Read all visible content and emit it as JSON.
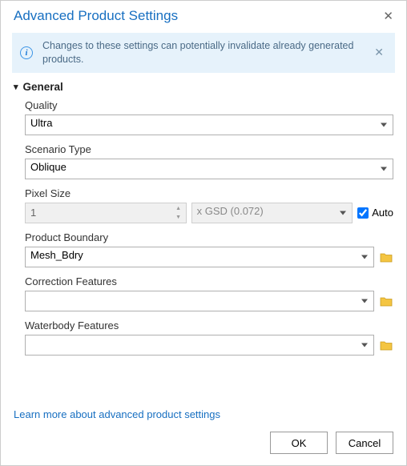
{
  "dialog": {
    "title": "Advanced Product Settings"
  },
  "banner": {
    "text": "Changes to these settings can potentially invalidate already generated products."
  },
  "section": {
    "general_label": "General"
  },
  "fields": {
    "quality": {
      "label": "Quality",
      "value": "Ultra"
    },
    "scenario": {
      "label": "Scenario Type",
      "value": "Oblique"
    },
    "pixel_size": {
      "label": "Pixel Size",
      "value": "1",
      "gsd": "x GSD (0.072)",
      "auto_label": "Auto",
      "auto_checked": true
    },
    "boundary": {
      "label": "Product Boundary",
      "value": "Mesh_Bdry"
    },
    "correction": {
      "label": "Correction Features",
      "value": ""
    },
    "waterbody": {
      "label": "Waterbody Features",
      "value": ""
    }
  },
  "footer": {
    "learn_more": "Learn more about advanced product settings",
    "ok": "OK",
    "cancel": "Cancel"
  }
}
